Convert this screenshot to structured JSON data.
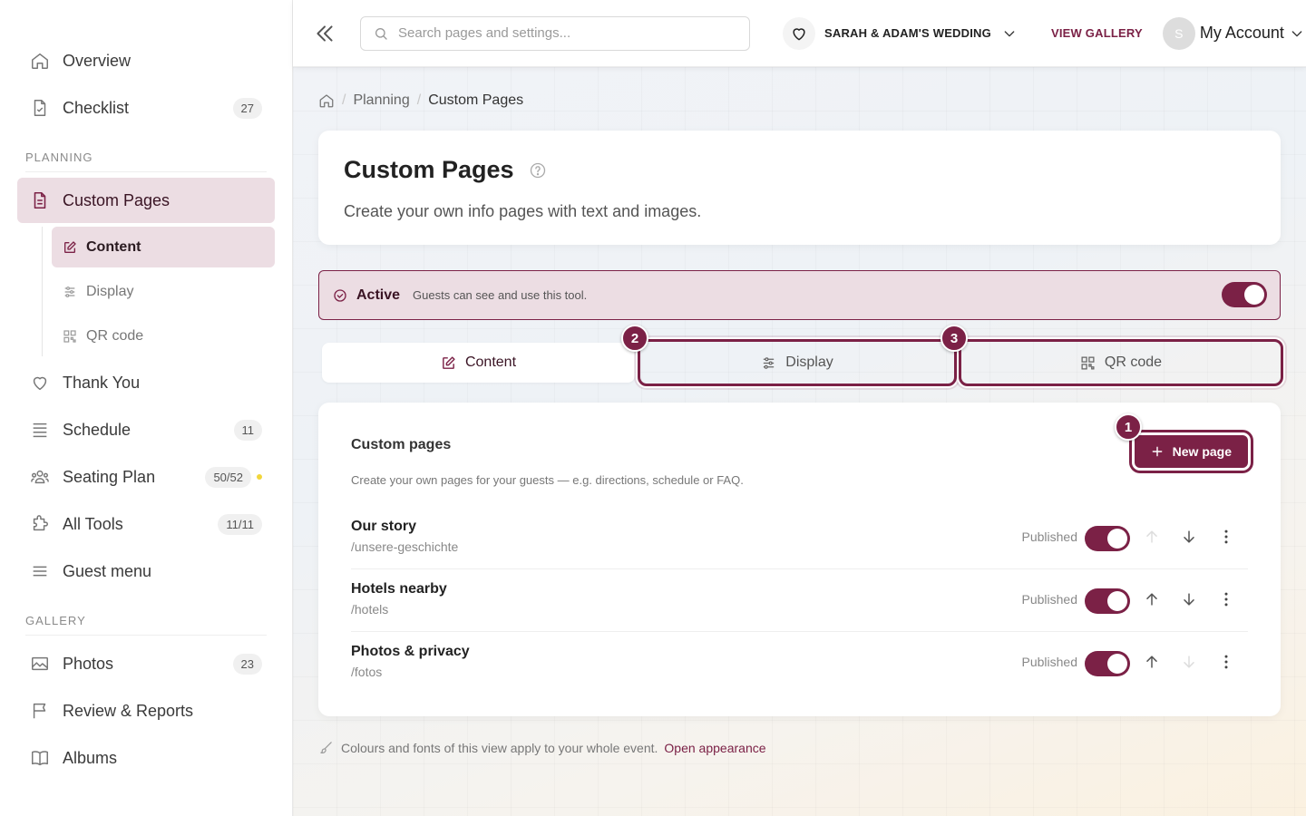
{
  "sidebar": {
    "overview": {
      "label": "Overview"
    },
    "checklist": {
      "label": "Checklist",
      "count": "27"
    },
    "planning_title": "PLANNING",
    "custom_pages": {
      "label": "Custom Pages"
    },
    "sub": {
      "content": "Content",
      "display": "Display",
      "qr": "QR code"
    },
    "thank_you": {
      "label": "Thank You"
    },
    "schedule": {
      "label": "Schedule",
      "count": "11"
    },
    "seating": {
      "label": "Seating Plan",
      "count": "50/52"
    },
    "all_tools": {
      "label": "All Tools",
      "count": "11/11"
    },
    "guest_menu": {
      "label": "Guest menu"
    },
    "gallery_title": "GALLERY",
    "photos": {
      "label": "Photos",
      "count": "23"
    },
    "review": {
      "label": "Review & Reports"
    },
    "albums": {
      "label": "Albums"
    }
  },
  "topbar": {
    "search_placeholder": "Search pages and settings...",
    "event_name": "SARAH & ADAM'S WEDDING",
    "view_gallery": "VIEW GALLERY",
    "avatar_initial": "S",
    "account_label": "My Account"
  },
  "breadcrumb": {
    "planning": "Planning",
    "current": "Custom Pages"
  },
  "header": {
    "title": "Custom Pages",
    "description": "Create your own info pages with text and images."
  },
  "status": {
    "label": "Active",
    "description": "Guests can see and use this tool.",
    "enabled": true
  },
  "tabs": {
    "content": "Content",
    "display": "Display",
    "qr": "QR code"
  },
  "markers": {
    "m1": "1",
    "m2": "2",
    "m3": "3"
  },
  "list": {
    "title": "Custom pages",
    "description": "Create your own pages for your guests — e.g. directions, schedule or FAQ.",
    "new_button": "New page",
    "rows": [
      {
        "title": "Our story",
        "slug": "/unsere-geschichte",
        "status": "Published"
      },
      {
        "title": "Hotels nearby",
        "slug": "/hotels",
        "status": "Published"
      },
      {
        "title": "Photos & privacy",
        "slug": "/fotos",
        "status": "Published"
      }
    ]
  },
  "footer": {
    "note": "Colours and fonts of this view apply to your whole event.",
    "link": "Open appearance"
  },
  "colors": {
    "accent": "#7b2146",
    "accent_soft": "#ecdde3",
    "dot": "#f2d63b"
  }
}
